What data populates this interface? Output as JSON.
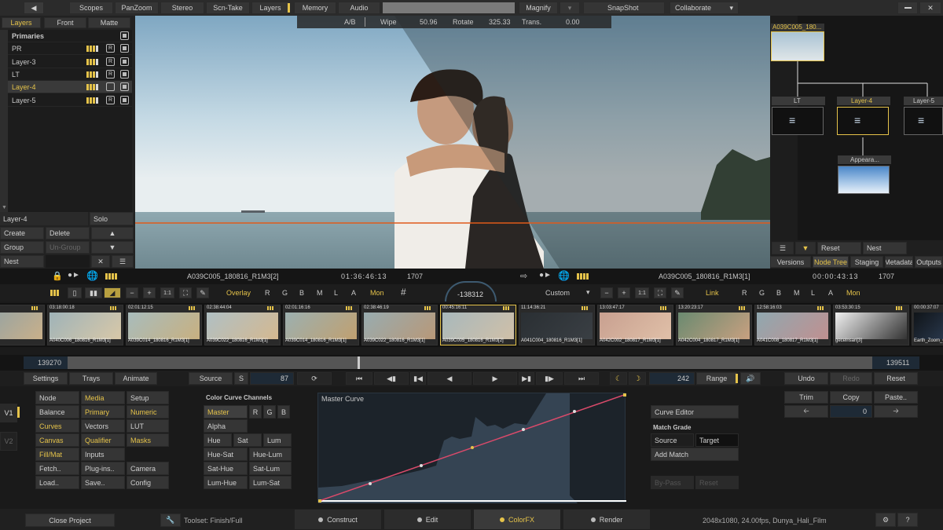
{
  "top_menu": {
    "back_icon": "back-arrow-icon",
    "items": [
      "Scopes",
      "PanZoom",
      "Stereo",
      "Scn-Take",
      "Layers",
      "Memory",
      "Audio"
    ],
    "magnify": "Magnify",
    "snapshot": "SnapShot",
    "collaborate": "Collaborate"
  },
  "layers_panel": {
    "tabs": [
      "Layers",
      "Front",
      "Matte"
    ],
    "rows": [
      "Primaries",
      "PR",
      "Layer-3",
      "LT",
      "Layer-4",
      "Layer-5"
    ],
    "selected": "Layer-4",
    "current_layer": "Layer-4",
    "solo": "Solo",
    "create": "Create",
    "delete": "Delete",
    "group": "Group",
    "ungroup": "Un-Group",
    "nest": "Nest"
  },
  "viewer": {
    "ab": "A/B",
    "wipe_label": "Wipe",
    "wipe_value": "50.96",
    "rotate_label": "Rotate",
    "rotate_value": "325.33",
    "trans_label": "Trans.",
    "trans_value": "0.00"
  },
  "node_tree": {
    "top_node": "A039C005_180...",
    "nodes": [
      "LT",
      "Layer-4",
      "Layer-5"
    ],
    "appearance": "Appeara...",
    "reset": "Reset",
    "nest": "Nest",
    "tabs": [
      "Versions",
      "Node Tree",
      "Staging",
      "Metadata",
      "Outputs"
    ],
    "active_tab": "Node Tree"
  },
  "clip_bar_left": {
    "name": "A039C005_180816_R1M3[2]",
    "timecode": "01:36:46:13",
    "frame": "1707"
  },
  "clip_bar_right": {
    "name": "A039C005_180816_R1M3[1]",
    "timecode": "00:00:43:13",
    "frame": "1707"
  },
  "overlay_bar": {
    "overlay": "Overlay",
    "left_channels": [
      "R",
      "G",
      "B",
      "M",
      "L",
      "A"
    ],
    "mon": "Mon",
    "offset": "-138312",
    "custom": "Custom",
    "link": "Link",
    "right_channels": [
      "R",
      "G",
      "B",
      "M",
      "L",
      "A"
    ],
    "mon2": "Mon"
  },
  "thumbnails": [
    {
      "tc": "",
      "name": "6_R1M3[1]",
      "c1": "#8aa0a8",
      "c2": "#c9b08a"
    },
    {
      "tc": "03:18:00:18",
      "name": "A040C006_180816_R1M3[1]",
      "c1": "#9fb3b8",
      "c2": "#d8c8a8"
    },
    {
      "tc": "02:01:12:15",
      "name": "A039C014_180816_R1M3[1]",
      "c1": "#a8bcbc",
      "c2": "#c8b080"
    },
    {
      "tc": "02:38:44:04",
      "name": "A039C022_180816_R1M3[1]",
      "c1": "#b0c0c4",
      "c2": "#d4b890"
    },
    {
      "tc": "02:01:16:16",
      "name": "A039C014_180816_R1M3[1]",
      "c1": "#9cb0b0",
      "c2": "#c0a070"
    },
    {
      "tc": "02:38:46:19",
      "name": "A039C022_180816_R1M3[1]",
      "c1": "#98acb0",
      "c2": "#b89878"
    },
    {
      "tc": "00:45:16:11",
      "name": "A039C005_180816_R1M3[2]",
      "c1": "#a8b8bc",
      "c2": "#d0c0a8"
    },
    {
      "tc": "11:14:36:21",
      "name": "A041C004_180816_R1M3[1]",
      "c1": "#2a2f33",
      "c2": "#3a3f44"
    },
    {
      "tc": "13:03:47:17",
      "name": "A042C002_180817_R1M3[1]",
      "c1": "#c8a090",
      "c2": "#e0c0a8"
    },
    {
      "tc": "13:20:23:17",
      "name": "A042C004_180817_R1M3[1]",
      "c1": "#6a8a70",
      "c2": "#c8a080"
    },
    {
      "tc": "12:58:16:03",
      "name": "A041C008_180817_R1M3[1]",
      "c1": "#90a8b0",
      "c2": "#c09090"
    },
    {
      "tc": "03:53:30:15",
      "name": "gecelnsari[3]",
      "c1": "#f0f0f0",
      "c2": "#333333"
    },
    {
      "tc": "00:00:37:07",
      "name": "Earth_Zoom_Clo",
      "c1": "#101418",
      "c2": "#3a5070"
    }
  ],
  "timeline": {
    "start": "139270",
    "end": "139511"
  },
  "transport": {
    "settings": "Settings",
    "trays": "Trays",
    "animate": "Animate",
    "source": "Source",
    "s": "S",
    "source_value": "87",
    "frame_value": "242",
    "range": "Range",
    "undo": "Undo",
    "redo": "Redo",
    "reset": "Reset"
  },
  "versions": [
    "V1",
    "V2"
  ],
  "tool_menu": [
    [
      "Node",
      "Media",
      "Setup"
    ],
    [
      "Balance",
      "Primary",
      "Numeric"
    ],
    [
      "Curves",
      "Vectors",
      "LUT"
    ],
    [
      "Canvas",
      "Qualifier",
      "Masks"
    ],
    [
      "Fill/Mat",
      "Inputs",
      ""
    ],
    [
      "Fetch..",
      "Plug-ins..",
      "Camera"
    ],
    [
      "Load..",
      "Save..",
      "Config"
    ]
  ],
  "curve_channels": {
    "title": "Color Curve Channels",
    "master": "Master",
    "rgb": [
      "R",
      "G",
      "B"
    ],
    "alpha": "Alpha",
    "row3": [
      "Hue",
      "Sat",
      "Lum"
    ],
    "row4": [
      "Hue-Sat",
      "Hue-Lum"
    ],
    "row5": [
      "Sat-Hue",
      "Sat-Lum"
    ],
    "row6": [
      "Lum-Hue",
      "Lum-Sat"
    ]
  },
  "master_curve": {
    "title": "Master Curve"
  },
  "curve_side": {
    "curve_editor": "Curve Editor",
    "match_grade": "Match Grade",
    "source": "Source",
    "target": "Target",
    "add_match": "Add Match",
    "bypass": "By-Pass",
    "reset": "Reset"
  },
  "edit_tools": {
    "trim": "Trim",
    "copy": "Copy",
    "paste": "Paste..",
    "value": "0"
  },
  "status_bar": {
    "close_project": "Close Project",
    "toolset": "Toolset: Finish/Full",
    "modes": [
      "Construct",
      "Edit",
      "ColorFX",
      "Render"
    ],
    "active_mode": "ColorFX",
    "info": "2048x1080, 24.00fps, Dunya_Hali_Film",
    "help": "?"
  },
  "colors": {
    "accent": "#e5c34a",
    "panel": "#232323",
    "curve_line": "#d94a6a"
  }
}
